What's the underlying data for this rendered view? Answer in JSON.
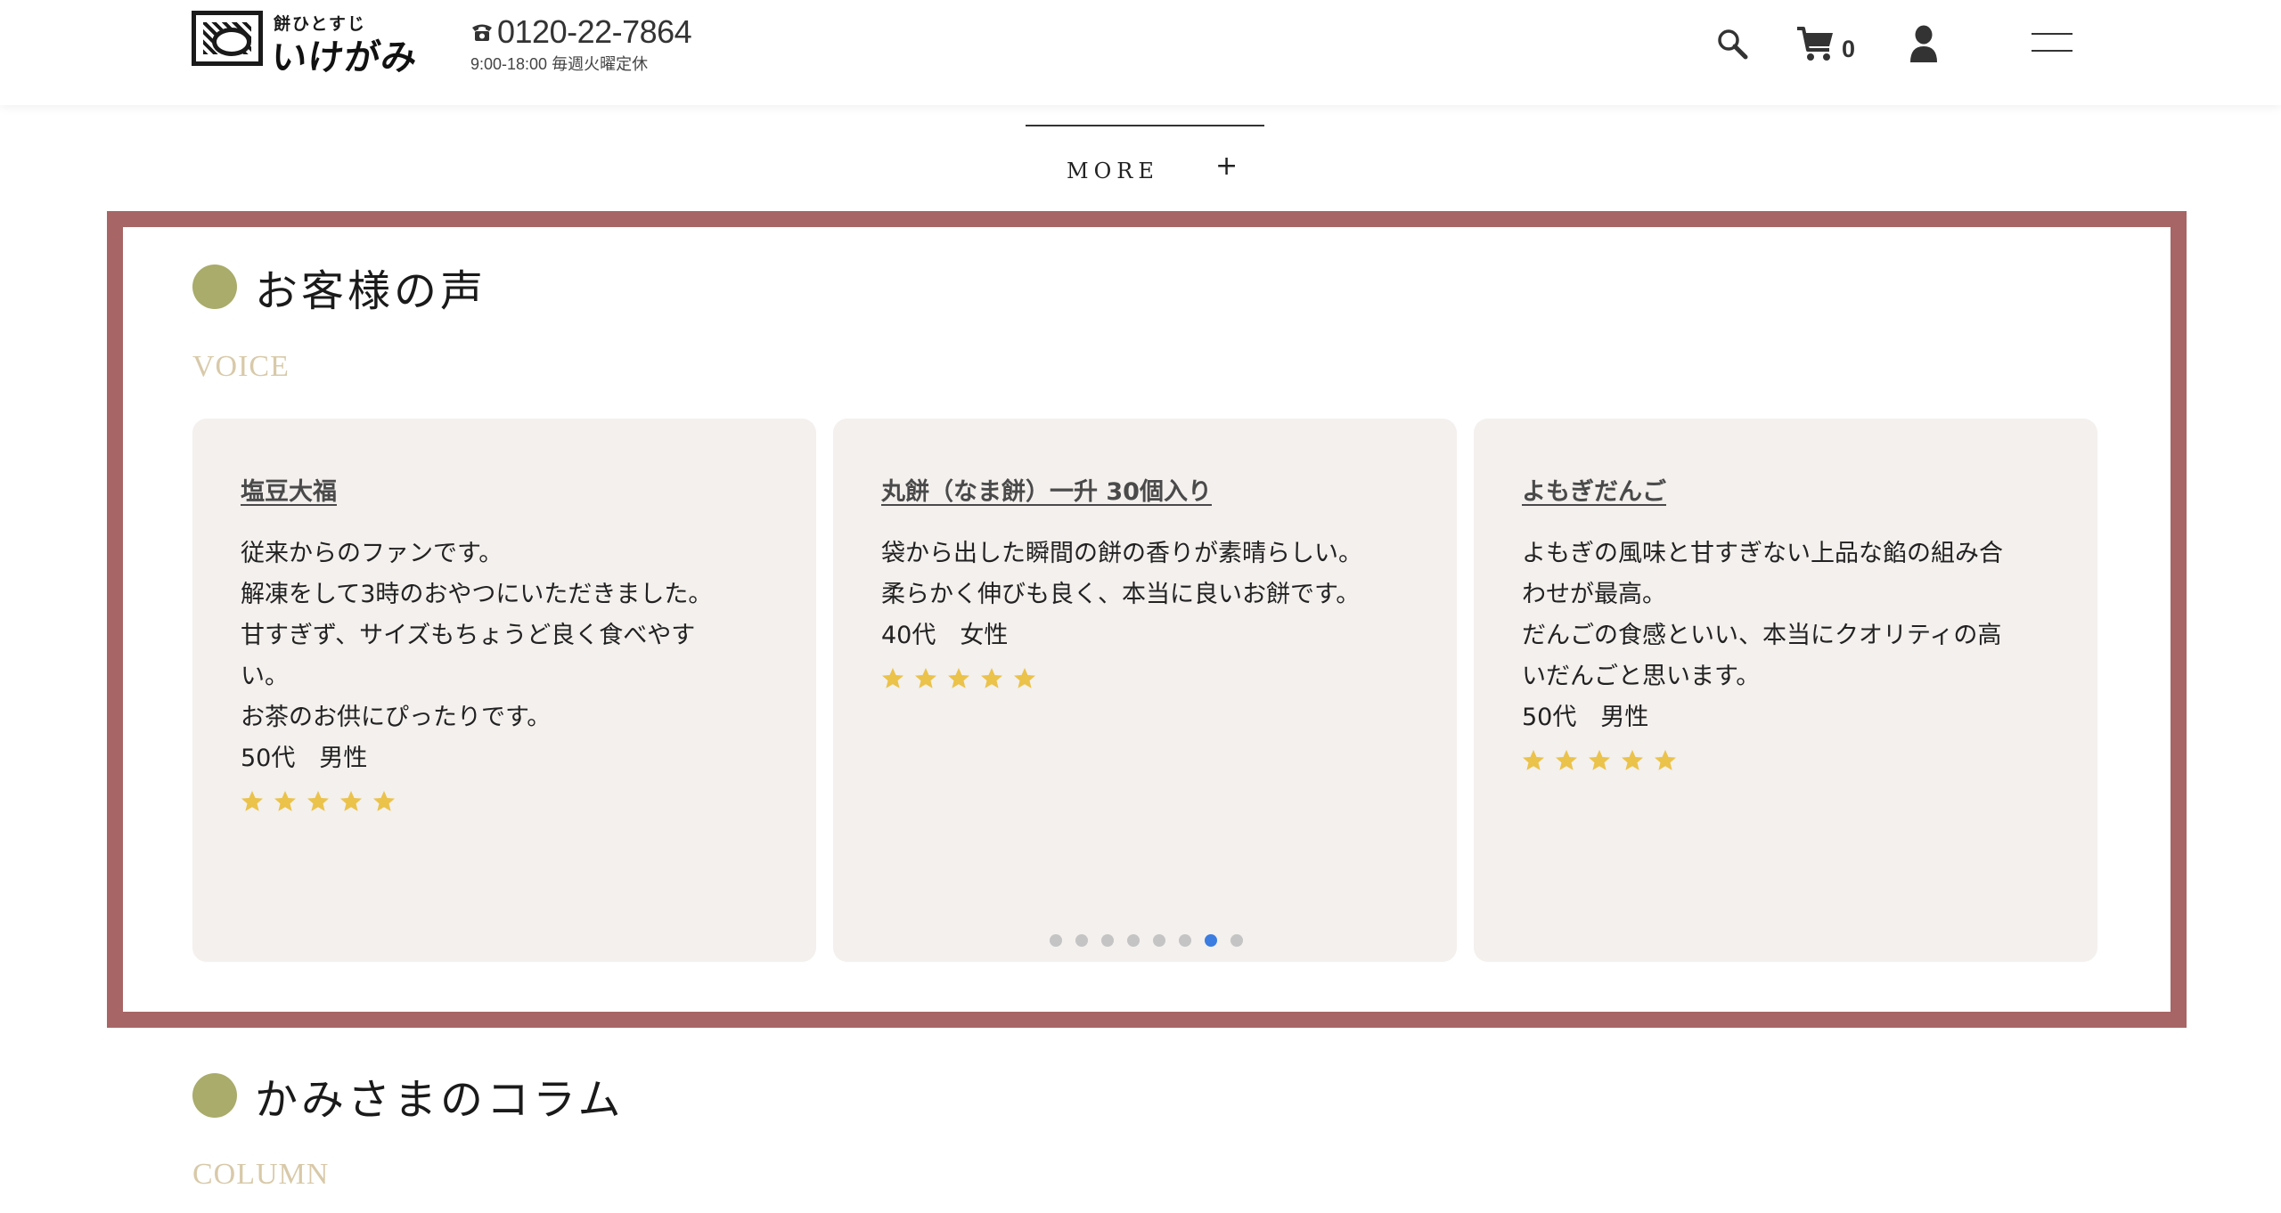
{
  "header": {
    "logo_small": "餅ひとすじ",
    "logo_big": "いけがみ",
    "phone_number": "0120-22-7864",
    "phone_hours": "9:00-18:00  毎週火曜定休",
    "cart_count": "0"
  },
  "more": {
    "label": "MORE",
    "plus": "+"
  },
  "voice": {
    "title": "お客様の声",
    "subtitle": "VOICE",
    "cards": [
      {
        "title": "塩豆大福",
        "lines": [
          "従来からのファンです。",
          "解凍をして3時のおやつにいただきました。",
          "甘すぎず、サイズもちょうど良く食べやす",
          "い。",
          "お茶のお供にぴったりです。"
        ],
        "meta": "50代　男性",
        "rating": 5
      },
      {
        "title": "丸餅（なま餅）一升 30個入り",
        "lines": [
          "袋から出した瞬間の餅の香りが素晴らしい。",
          "柔らかく伸びも良く、本当に良いお餅です。"
        ],
        "meta": "40代　女性",
        "rating": 5
      },
      {
        "title": "よもぎだんご",
        "lines": [
          "よもぎの風味と甘すぎない上品な餡の組み合",
          "わせが最高。",
          "だんごの食感といい、本当にクオリティの高",
          "いだんごと思います。"
        ],
        "meta": "50代　男性",
        "rating": 5
      }
    ],
    "pagination": {
      "total": 8,
      "active": 7
    }
  },
  "column": {
    "title": "かみさまのコラム",
    "subtitle": "COLUMN"
  },
  "colors": {
    "frame": "#a76565",
    "dot_accent": "#a9ac6a",
    "subtitle": "#d8c9a9",
    "card_bg": "#f3f0ed",
    "star": "#ebc24a",
    "pager_active": "#3b7de0"
  },
  "icons": [
    "phone-icon",
    "search-icon",
    "cart-icon",
    "user-icon",
    "hamburger-menu-icon",
    "star-icon"
  ]
}
